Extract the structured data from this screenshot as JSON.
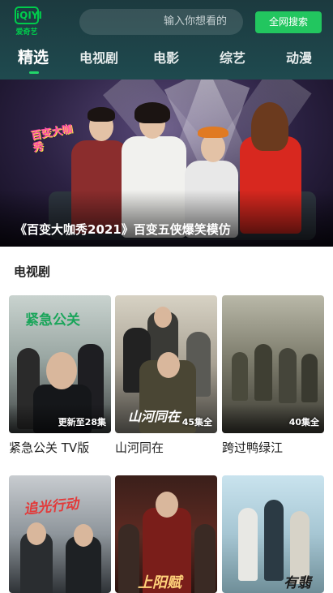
{
  "header": {
    "logo_text": "iQIYI",
    "logo_sub": "爱奇艺",
    "search_placeholder": "输入你想看的",
    "search_button": "全网搜索",
    "brand_color": "#00cc4c"
  },
  "nav": {
    "tabs": [
      "精选",
      "电视剧",
      "电影",
      "综艺",
      "动漫"
    ],
    "active": "精选"
  },
  "banner": {
    "title": "《百变大咖秀2021》百变五侠爆笑模仿",
    "show_logo": "百变大咖秀"
  },
  "section": {
    "title": "电视剧",
    "cards": [
      {
        "title": "紧急公关 TV版",
        "badge": "更新至28集",
        "poster_text": "紧急公关"
      },
      {
        "title": "山河同在",
        "badge": "45集全",
        "poster_text": "山河同在"
      },
      {
        "title": "跨过鸭绿江",
        "badge": "40集全",
        "poster_text": ""
      },
      {
        "title": "",
        "badge": "",
        "poster_text": "追光行动"
      },
      {
        "title": "",
        "badge": "",
        "poster_text": "上阳赋"
      },
      {
        "title": "",
        "badge": "",
        "poster_text": "有翡"
      }
    ]
  }
}
